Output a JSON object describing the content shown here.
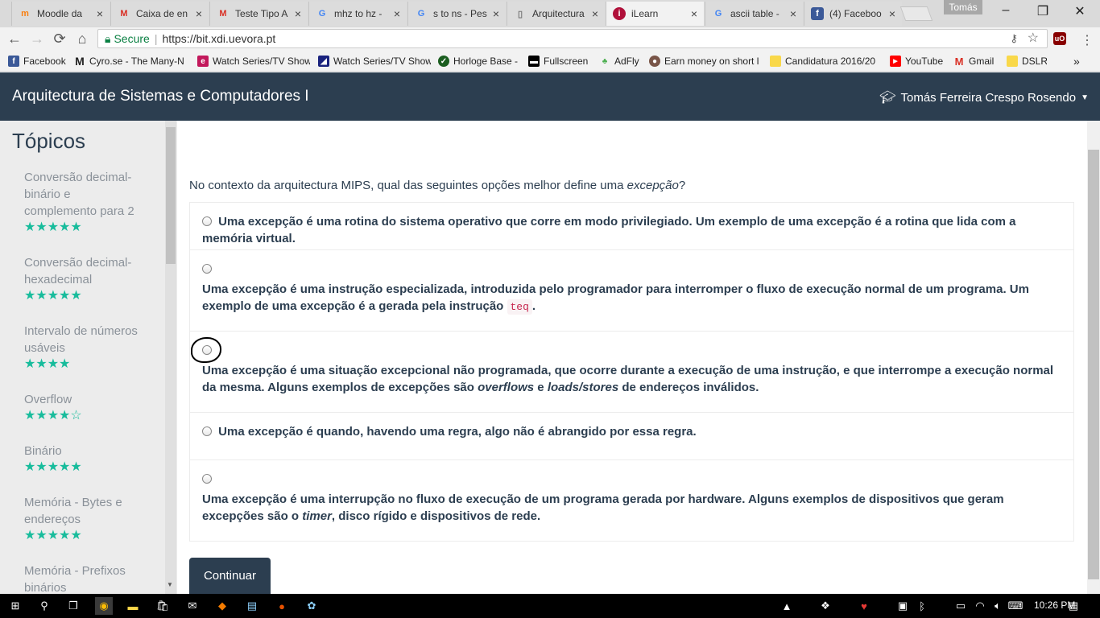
{
  "browser": {
    "tabs": [
      {
        "title": "Moodle da",
        "icon": "moodle-icon",
        "color": "#f98012"
      },
      {
        "title": "Caixa de en",
        "icon": "gmail-icon",
        "color": "#d93025"
      },
      {
        "title": "Teste Tipo A",
        "icon": "gmail-icon",
        "color": "#d93025"
      },
      {
        "title": "mhz to hz -",
        "icon": "google-icon",
        "color": "#4285f4"
      },
      {
        "title": "s to ns - Pes",
        "icon": "google-icon",
        "color": "#4285f4"
      },
      {
        "title": "Arquitectura",
        "icon": "page-icon",
        "color": "#777777"
      },
      {
        "title": "iLearn",
        "icon": "ilearn-icon",
        "color": "#b0103a"
      },
      {
        "title": "ascii table -",
        "icon": "google-icon",
        "color": "#4285f4"
      },
      {
        "title": "(4) Faceboo",
        "icon": "facebook-icon",
        "color": "#3b5998"
      }
    ],
    "profile_name": "Tomás",
    "window_controls": {
      "minimize": "–",
      "restore": "❐",
      "close": "✕"
    },
    "nav": {
      "back": "←",
      "forward": "→",
      "reload": "⟳",
      "home": "⌂"
    },
    "address": {
      "secure_label": "Secure",
      "url": "https://bit.xdi.uevora.pt"
    },
    "bookmarks": [
      {
        "label": "Facebook",
        "icon": "facebook-icon",
        "color": "#3b5998"
      },
      {
        "label": "Cyro.se - The Many-N",
        "icon": "m-icon",
        "color": "#000000"
      },
      {
        "label": "Watch Series/TV Show",
        "icon": "e-icon",
        "color": "#c2185b"
      },
      {
        "label": "Watch Series/TV Show",
        "icon": "tv-icon",
        "color": "#1a237e"
      },
      {
        "label": "Horloge Base -",
        "icon": "check-icon",
        "color": "#1b5e20"
      },
      {
        "label": "Fullscreen",
        "icon": "fullscreen-icon",
        "color": "#000000"
      },
      {
        "label": "AdFly",
        "icon": "adfly-icon",
        "color": "#4caf50"
      },
      {
        "label": "Earn money on short l",
        "icon": "earn-icon",
        "color": "#795548"
      },
      {
        "label": "Candidatura 2016/20",
        "icon": "folder-icon",
        "color": "#f9d84a"
      },
      {
        "label": "YouTube",
        "icon": "youtube-icon",
        "color": "#ff0000"
      },
      {
        "label": "Gmail",
        "icon": "gmail-icon",
        "color": "#d93025"
      },
      {
        "label": "DSLR",
        "icon": "folder-icon",
        "color": "#f9d84a"
      }
    ],
    "bookmarks_overflow": "»"
  },
  "header": {
    "title": "Arquitectura de Sistemas e Computadores I",
    "user_name": "Tomás Ferreira Crespo Rosendo"
  },
  "sidebar": {
    "heading": "Tópicos",
    "topics": [
      {
        "label": "Conversão decimal-binário e complemento para 2",
        "stars": "★★★★★"
      },
      {
        "label": "Conversão decimal-hexadecimal",
        "stars": "★★★★★"
      },
      {
        "label": "Intervalo de números usáveis",
        "stars": "★★★★"
      },
      {
        "label": "Overflow",
        "stars": "★★★★",
        "empty_stars": "☆"
      },
      {
        "label": "Binário",
        "stars": "★★★★★"
      },
      {
        "label": "Memória - Bytes e endereços",
        "stars": "★★★★★"
      },
      {
        "label": "Memória - Prefixos binários",
        "stars": ""
      }
    ]
  },
  "quiz": {
    "question_prefix": "No contexto da arquitectura MIPS, qual das seguintes opções melhor define uma ",
    "question_term": "excepção",
    "question_suffix": "?",
    "answers": {
      "a1": "Uma excepção é uma rotina do sistema operativo que corre em modo privilegiado. Um exemplo de uma excepção é a rotina que lida com a memória virtual.",
      "a2_text": "Uma excepção é uma instrução especializada, introduzida pelo programador para interromper o fluxo de execução normal de um programa. Um exemplo de uma excepção é a gerada pela instrução",
      "a2_code": "teq",
      "a2_end": ".",
      "a3_text1": "Uma excepção é uma situação excepcional não programada, que ocorre durante a execução de uma instrução, e que interrompe a execução normal da mesma. Alguns exemplos de excepções são ",
      "a3_em1": "overflows",
      "a3_mid": " e ",
      "a3_em2": "loads/stores",
      "a3_text2": " de endereços inválidos.",
      "a4": "Uma excepção é quando, havendo uma regra, algo não é abrangido por essa regra.",
      "a5_text1": "Uma excepção é uma interrupção no fluxo de execução de um programa gerada por hardware. Alguns exemplos de dispositivos que geram excepções são o ",
      "a5_em": "timer",
      "a5_text2": ", disco rígido e dispositivos de rede."
    },
    "continue_label": "Continuar"
  },
  "taskbar": {
    "time": "10:26 PM"
  },
  "colors": {
    "header_bg": "#2c3e50",
    "accent_stars": "#18bc9c",
    "code_text": "#c7254e"
  }
}
